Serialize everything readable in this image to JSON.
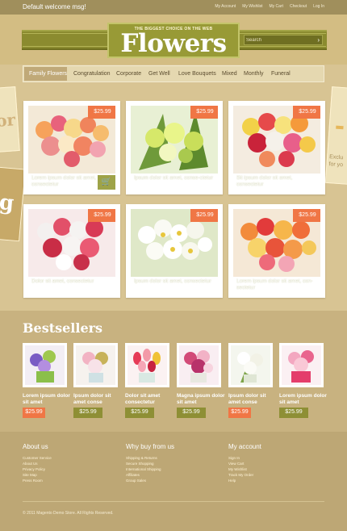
{
  "topbar": {
    "welcome": "Default welcome msg!",
    "links": [
      "My Account",
      "My Wishlist",
      "My Cart",
      "Checkout",
      "Log In"
    ]
  },
  "header": {
    "tagline": "THE BIGGEST CHOICE ON THE WEB",
    "logo": "Flowers",
    "search_placeholder": "Search"
  },
  "nav": {
    "items": [
      "Family Flowers",
      "Congratulation",
      "Corporate",
      "Get Well",
      "Love Bouquets",
      "Mixed",
      "Monthly",
      "Funeral"
    ]
  },
  "promos": {
    "left_top": "or",
    "left_bottom": "g",
    "right_top": "-",
    "right_bottom": "Exclu\nfor yo"
  },
  "products": [
    {
      "price": "$25.99",
      "caption": "Lorem ipsum dolor sit amet, consectetur"
    },
    {
      "price": "$25.99",
      "caption": "Ipsum dolor sit amet, conse-ctetur"
    },
    {
      "price": "$25.99",
      "caption": "Sit ipsum dolor sit amet, consectetur"
    },
    {
      "price": "$25.99",
      "caption": "Dolor sit amet, consectetur"
    },
    {
      "price": "$25.99",
      "caption": "Ipsum dolor sit amet, consectetur"
    },
    {
      "price": "$25.99",
      "caption": "Lorem ipsum dolor sit amet, con-sectetur"
    }
  ],
  "bestsellers": {
    "title": "Bestsellers",
    "items": [
      {
        "caption": "Lorem ipsum dolor sit amet",
        "price": "$25.99",
        "style": "orange"
      },
      {
        "caption": "Ipsum dolor sit amet conse",
        "price": "$25.99",
        "style": "olive"
      },
      {
        "caption": "Dolor sit amet consectetur",
        "price": "$25.99",
        "style": "olive"
      },
      {
        "caption": "Magna ipsum dolor sit amet",
        "price": "$25.99",
        "style": "olive"
      },
      {
        "caption": "Ipsum dolor sit amet conse",
        "price": "$25.99",
        "style": "orange"
      },
      {
        "caption": "Lorem ipsum dolor sit amet",
        "price": "$25.99",
        "style": "olive"
      }
    ]
  },
  "footer": {
    "about": {
      "title": "About us",
      "links": [
        "Customer Service",
        "About Us",
        "Privacy Policy",
        "Site Map",
        "Press Room"
      ]
    },
    "why": {
      "title": "Why buy from us",
      "links": [
        "Shipping & Returns",
        "Secure Shopping",
        "International Shipping",
        "Affiliates",
        "Group Sales"
      ]
    },
    "account": {
      "title": "My account",
      "links": [
        "Sign In",
        "View Cart",
        "My Wishlist",
        "Track My Order",
        "Help"
      ]
    },
    "copyright": "© 2011 Magento Demo Store. All Rights Reserved."
  },
  "colors": {
    "background": "#d8c493",
    "olive": "#8e8f35",
    "price_orange": "#f07645",
    "nav_bg": "#e5d8b0"
  }
}
